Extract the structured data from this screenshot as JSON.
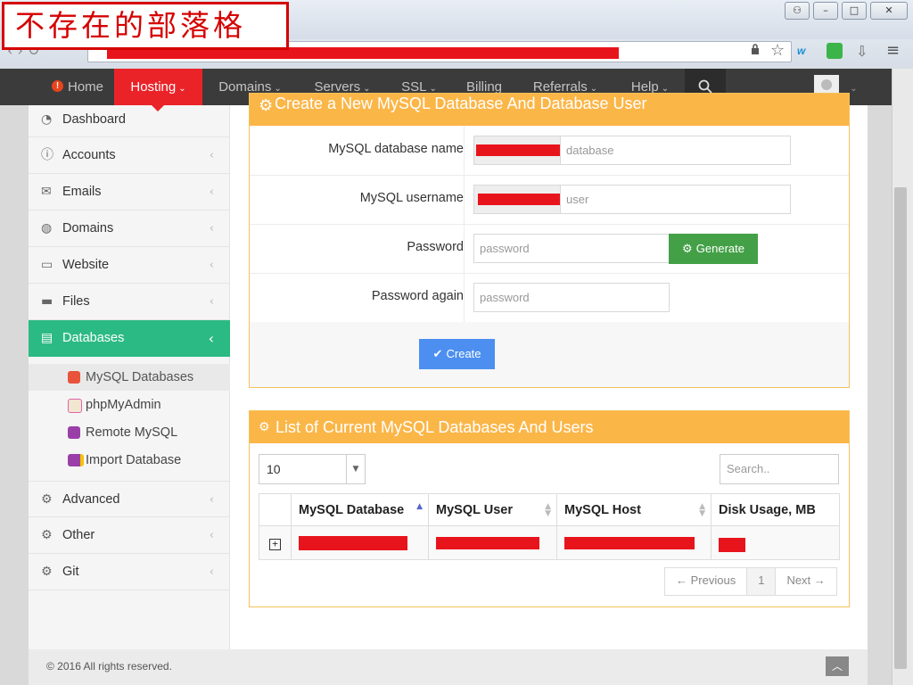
{
  "overlay": {
    "text": "不存在的部落格"
  },
  "window_buttons": {
    "user": "⚇",
    "minimize": "–",
    "maximize": "□",
    "close": "✕"
  },
  "browser": {
    "ext_label": "w"
  },
  "navbar": {
    "items": [
      {
        "label": "Home"
      },
      {
        "label": "Hosting"
      },
      {
        "label": "Domains"
      },
      {
        "label": "Servers"
      },
      {
        "label": "SSL"
      },
      {
        "label": "Billing"
      },
      {
        "label": "Referrals"
      },
      {
        "label": "Help"
      }
    ],
    "accent": "#ea2329"
  },
  "sidebar": {
    "items": [
      {
        "label": "Dashboard",
        "icon": "dashboard-icon"
      },
      {
        "label": "Accounts",
        "icon": "info-icon"
      },
      {
        "label": "Emails",
        "icon": "envelope-icon"
      },
      {
        "label": "Domains",
        "icon": "globe-icon"
      },
      {
        "label": "Website",
        "icon": "monitor-icon"
      },
      {
        "label": "Files",
        "icon": "folder-icon"
      },
      {
        "label": "Databases",
        "icon": "archive-icon"
      },
      {
        "label": "Advanced",
        "icon": "gears-icon"
      },
      {
        "label": "Other",
        "icon": "gear-icon"
      },
      {
        "label": "Git",
        "icon": "gears-icon"
      }
    ],
    "sub_items": [
      {
        "label": "MySQL Databases"
      },
      {
        "label": "phpMyAdmin"
      },
      {
        "label": "Remote MySQL"
      },
      {
        "label": "Import Database"
      }
    ],
    "active_color": "#2cba84"
  },
  "create_panel": {
    "title": "Create a New MySQL Database And Database User",
    "db_name_label": "MySQL database name",
    "db_name_placeholder": "database",
    "username_label": "MySQL username",
    "username_placeholder": "user",
    "password_label": "Password",
    "password_placeholder": "password",
    "password_again_label": "Password again",
    "password_again_placeholder": "password",
    "generate_label": "Generate",
    "create_label": "Create"
  },
  "list_panel": {
    "title": "List of Current MySQL Databases And Users",
    "page_size": "10",
    "search_placeholder": "Search..",
    "columns": [
      "MySQL Database",
      "MySQL User",
      "MySQL Host",
      "Disk Usage, MB"
    ],
    "expand_symbol": "+",
    "pagination": {
      "previous": "← Previous",
      "page": "1",
      "next": "Next →"
    }
  },
  "footer": {
    "copyright": "© 2016 All rights reserved."
  },
  "colors": {
    "panel_header": "#fbb648",
    "generate": "#43a047",
    "create": "#4c8ff0",
    "redaction": "#e8141c"
  }
}
